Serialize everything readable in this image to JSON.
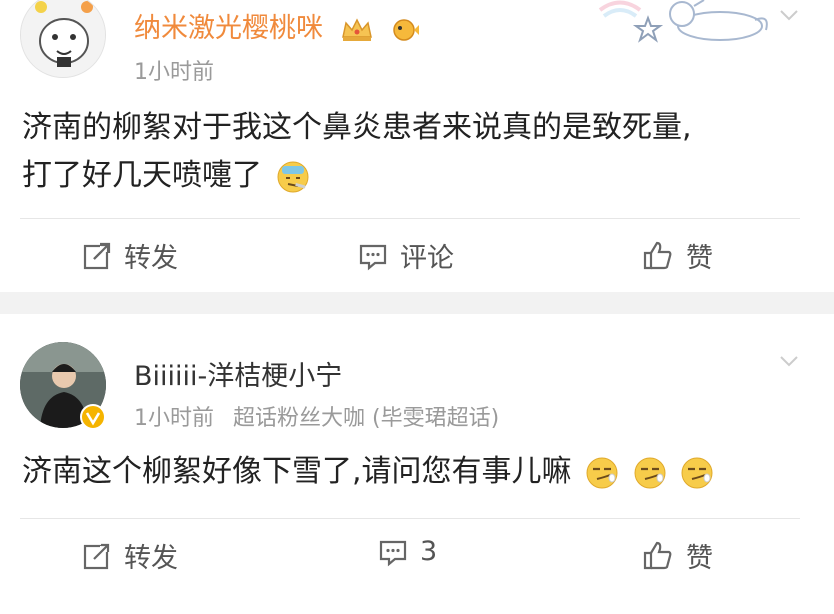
{
  "posts": [
    {
      "nickname": "纳米激光樱桃咪",
      "time": "1小时前",
      "tag": "",
      "content_lines": [
        "济南的柳絮对于我这个鼻炎患者来说真的是致死量,",
        "打了好几天喷嚏了"
      ],
      "actions": {
        "repost": "转发",
        "comment": "评论",
        "like": "赞"
      },
      "icons": [
        "crown-badge-icon",
        "pufferfish-badge-icon",
        "sick-face-emoji-icon",
        "chevron-down-icon",
        "unicorn-decoration-icon",
        "star-icon"
      ]
    },
    {
      "nickname": "Biiiiii-洋桔梗小宁",
      "time": "1小时前",
      "tag": "超话粉丝大咖 (毕雯珺超话)",
      "content_lines": [
        "济南这个柳絮好像下雪了,请问您有事儿嘛"
      ],
      "actions": {
        "repost": "转发",
        "comment": "3",
        "like": "赞"
      },
      "icons": [
        "verified-badge-icon",
        "smirk-emoji-icon",
        "chevron-down-icon"
      ]
    }
  ],
  "colors": {
    "nickname_vip": "#f08a3c",
    "verified_badge": "#f5b400",
    "separator": "#f2f2f2"
  }
}
